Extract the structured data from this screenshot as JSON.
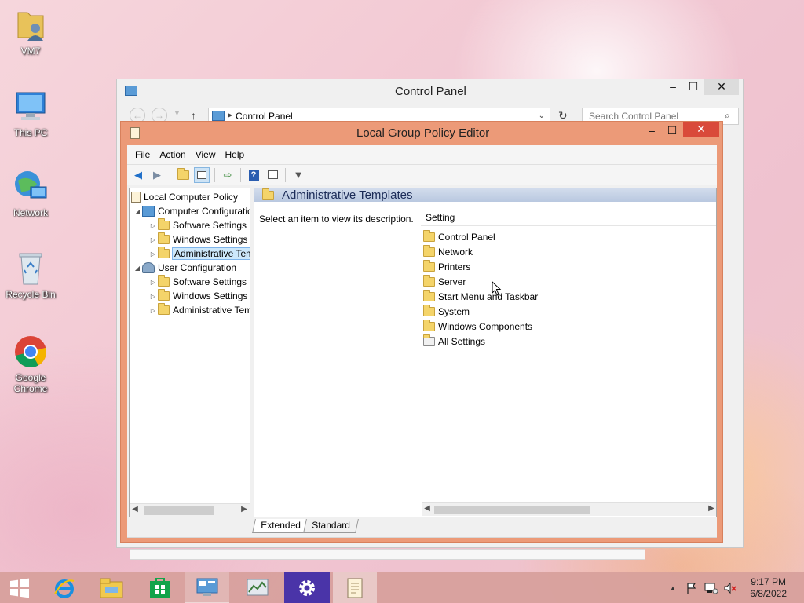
{
  "desktop": {
    "icons": [
      {
        "label": "VM7"
      },
      {
        "label": "This PC"
      },
      {
        "label": "Network"
      },
      {
        "label": "Recycle Bin"
      },
      {
        "label": "Google Chrome"
      }
    ]
  },
  "control_panel": {
    "title": "Control Panel",
    "address": "Control Panel",
    "search_placeholder": "Search Control Panel"
  },
  "gpe": {
    "title": "Local Group Policy Editor",
    "menu": [
      "File",
      "Action",
      "View",
      "Help"
    ],
    "tree": [
      {
        "label": "Local Computer Policy",
        "level": 0,
        "expanded": true
      },
      {
        "label": "Computer Configuration",
        "level": 1,
        "expanded": true
      },
      {
        "label": "Software Settings",
        "level": 2
      },
      {
        "label": "Windows Settings",
        "level": 2
      },
      {
        "label": "Administrative Templates",
        "level": 2,
        "selected": true
      },
      {
        "label": "User Configuration",
        "level": 1,
        "expanded": true
      },
      {
        "label": "Software Settings",
        "level": 2
      },
      {
        "label": "Windows Settings",
        "level": 2
      },
      {
        "label": "Administrative Templates",
        "level": 2
      }
    ],
    "right_header": "Administrative Templates",
    "description": "Select an item to view its description.",
    "column_setting": "Setting",
    "items": [
      {
        "label": "Control Panel",
        "icon": "folder-icon"
      },
      {
        "label": "Network",
        "icon": "folder-icon"
      },
      {
        "label": "Printers",
        "icon": "folder-icon"
      },
      {
        "label": "Server",
        "icon": "folder-icon"
      },
      {
        "label": "Start Menu and Taskbar",
        "icon": "folder-icon"
      },
      {
        "label": "System",
        "icon": "folder-icon"
      },
      {
        "label": "Windows Components",
        "icon": "folder-icon"
      },
      {
        "label": "All Settings",
        "icon": "settings-folder-icon"
      }
    ],
    "tabs": [
      "Extended",
      "Standard"
    ],
    "active_tab": "Extended"
  },
  "taskbar": {
    "time": "9:17 PM",
    "date": "6/8/2022"
  },
  "colors": {
    "gpe_frame": "#ec9a78",
    "taskbar": "#d7a09b"
  }
}
